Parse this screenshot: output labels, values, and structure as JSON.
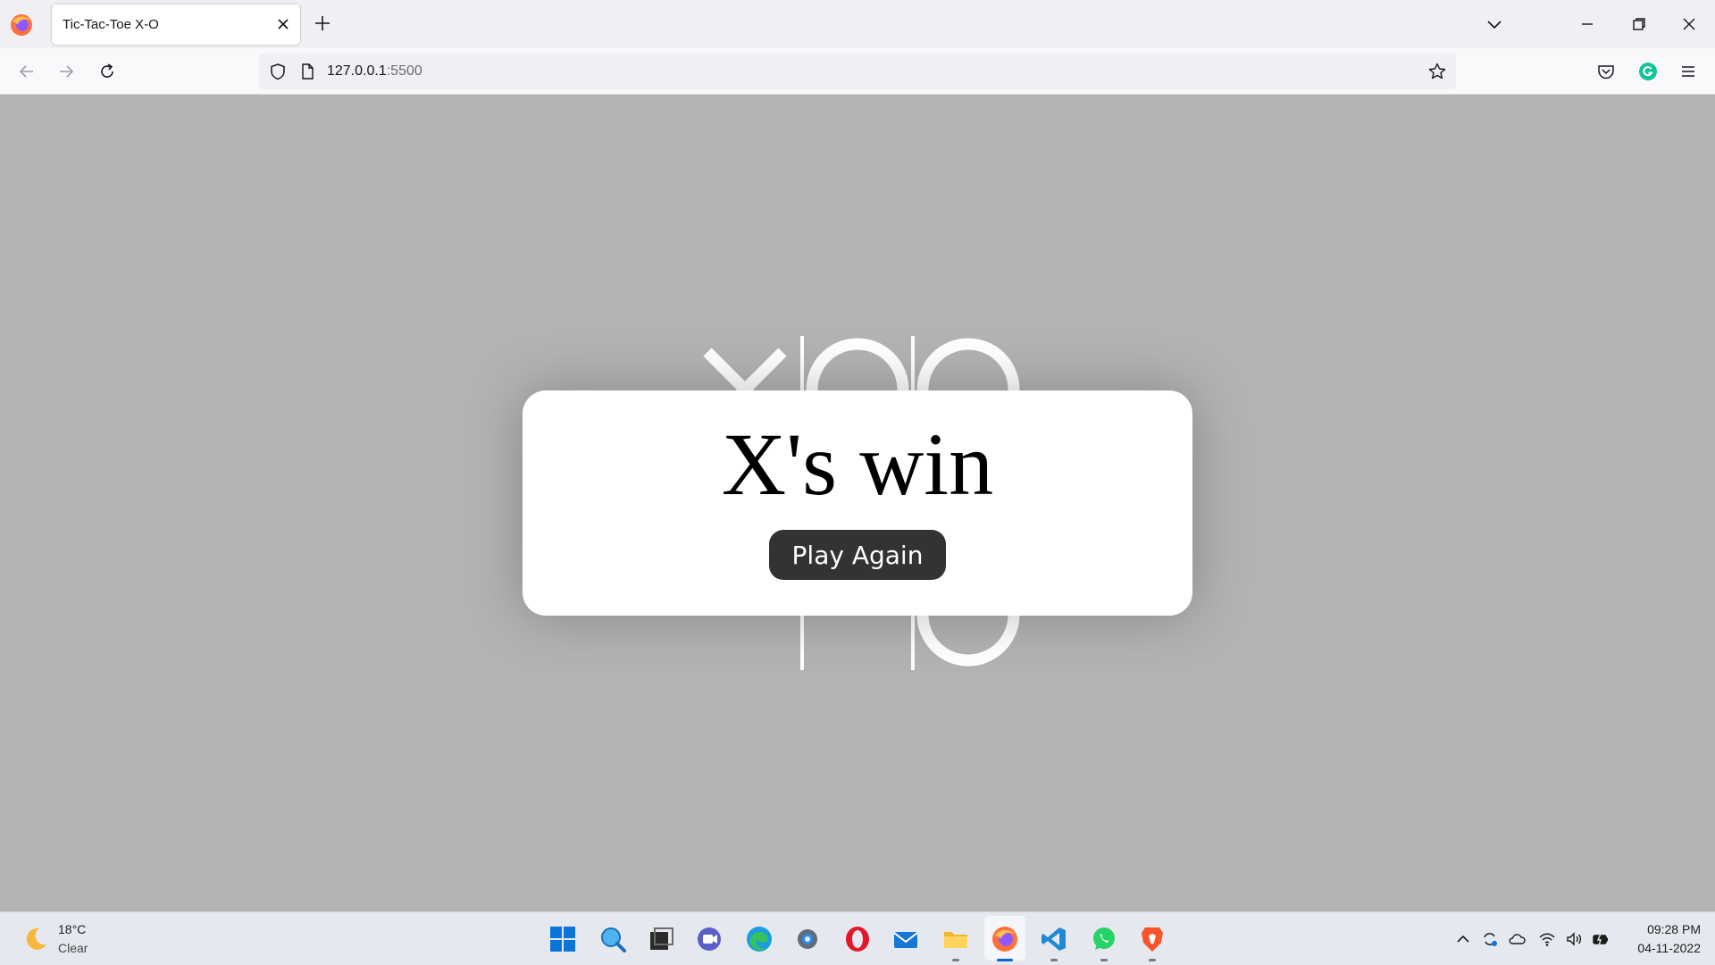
{
  "browser": {
    "tab_title": "Tic-Tac-Toe X-O",
    "url_host": "127.0.0.1",
    "url_port": ":5500"
  },
  "game": {
    "result_text": "X's win",
    "play_again_label": "Play Again"
  },
  "taskbar": {
    "weather_temp": "18°C",
    "weather_desc": "Clear",
    "time": "09:28 PM",
    "date": "04-11-2022"
  },
  "colors": {
    "page_background": "#b3b3b3",
    "board_lines": "#ffffff",
    "button_background": "#333333",
    "modal_background": "#ffffff"
  }
}
